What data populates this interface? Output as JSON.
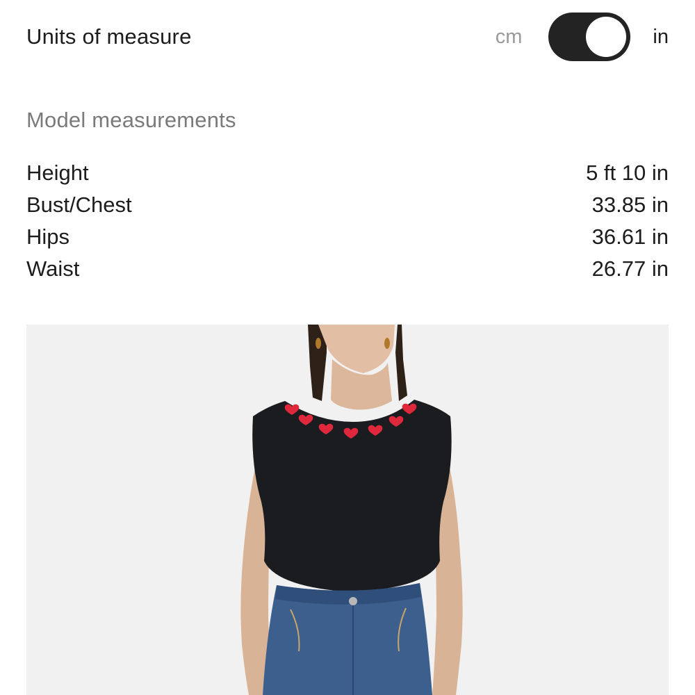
{
  "units": {
    "title": "Units of measure",
    "option_off": "cm",
    "option_on": "in",
    "selected": "in"
  },
  "model": {
    "section_title": "Model measurements",
    "rows": [
      {
        "label": "Height",
        "value": "5 ft 10 in"
      },
      {
        "label": "Bust/Chest",
        "value": "33.85 in"
      },
      {
        "label": "Hips",
        "value": "36.61 in"
      },
      {
        "label": "Waist",
        "value": "26.77 in"
      }
    ]
  },
  "photo": {
    "icon": "product-model-photo",
    "colors": {
      "background": "#f1f1f1",
      "top": "#1b1c20",
      "hearts": "#e0283c",
      "denim": "#3d5f8e"
    }
  }
}
